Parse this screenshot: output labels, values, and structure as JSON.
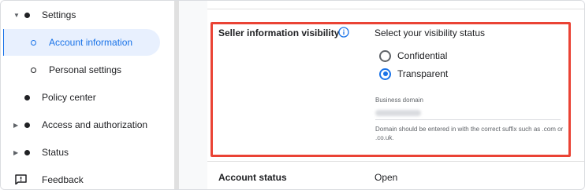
{
  "sidebar": {
    "items": [
      {
        "label": "Settings",
        "expanded": true
      },
      {
        "label": "Account information",
        "active": true
      },
      {
        "label": "Personal settings"
      },
      {
        "label": "Policy center"
      },
      {
        "label": "Access and authorization",
        "expandable": true
      },
      {
        "label": "Status",
        "expandable": true
      },
      {
        "label": "Feedback",
        "icon": "feedback-icon"
      }
    ]
  },
  "main": {
    "visibility": {
      "title": "Seller information visibility",
      "info_icon": "info-icon",
      "heading": "Select your visibility status",
      "options": [
        {
          "label": "Confidential",
          "selected": false
        },
        {
          "label": "Transparent",
          "selected": true
        }
      ],
      "domain_label": "Business domain",
      "domain_helper": "Domain should be entered in with the correct suffix such as .com or .co.uk."
    },
    "account_status": {
      "label": "Account status",
      "value": "Open"
    }
  },
  "colors": {
    "accent": "#1a73e8",
    "active_bg": "#e8f0fe",
    "highlight_border": "#ea4335"
  }
}
